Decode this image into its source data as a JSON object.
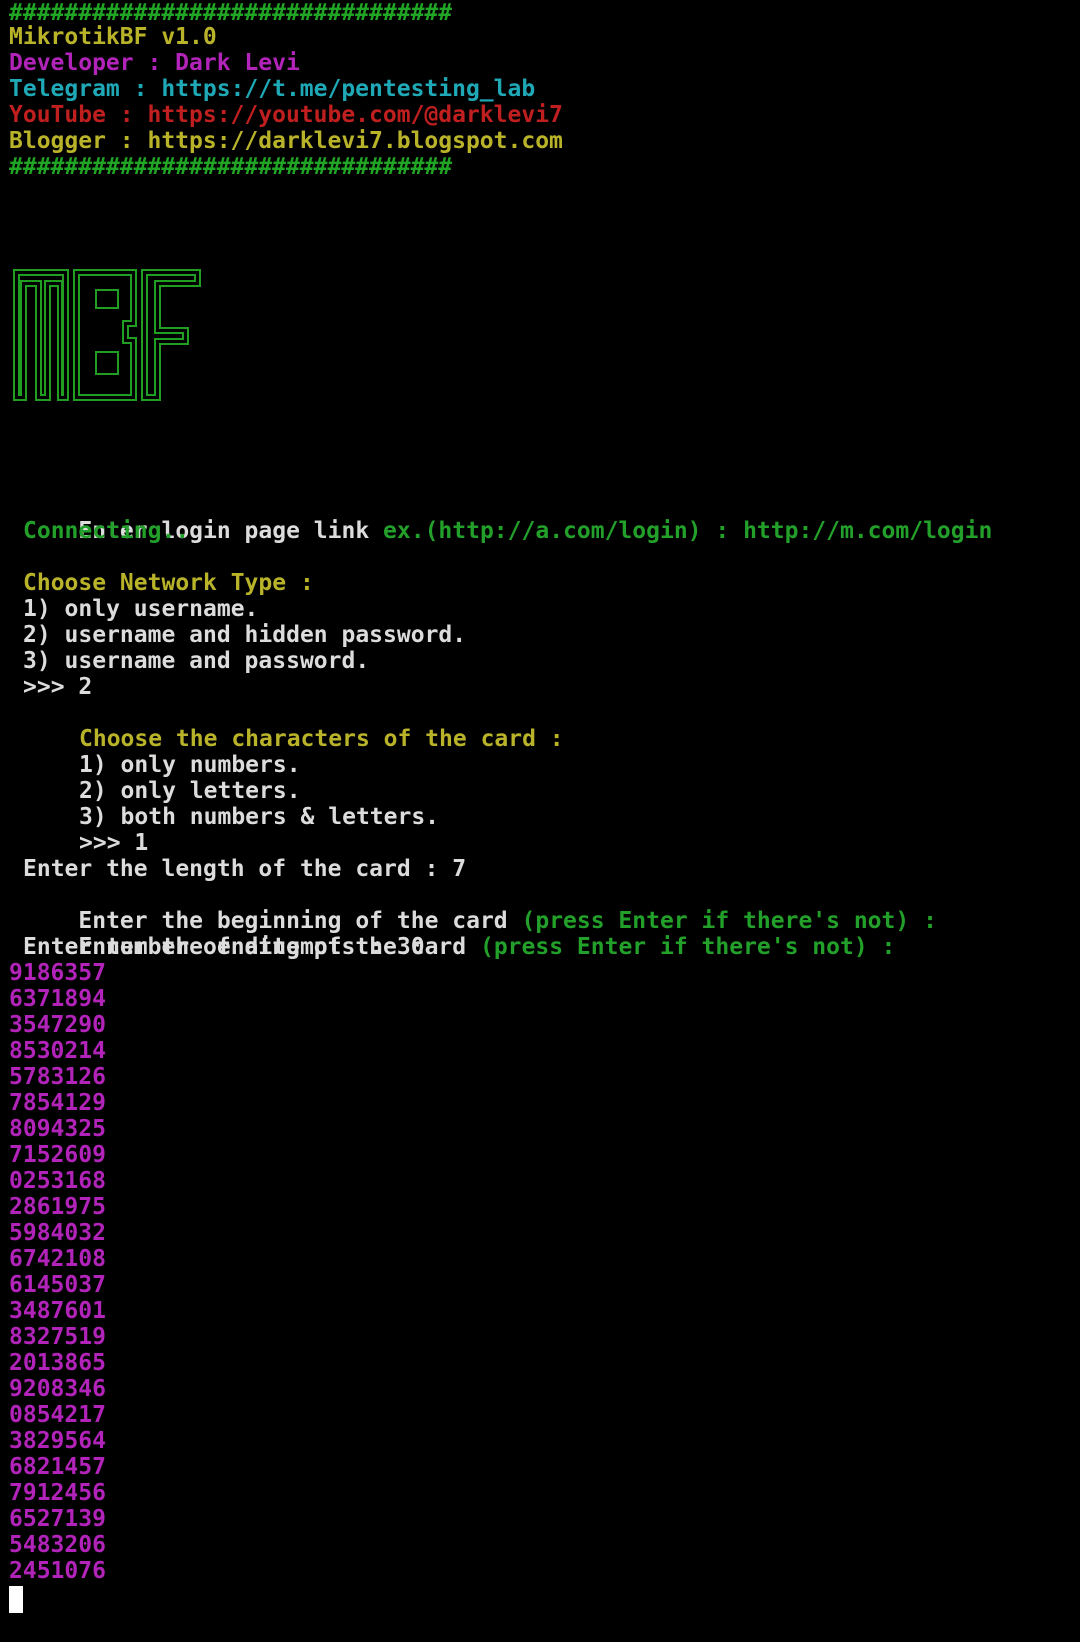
{
  "banner": {
    "hash_line": "################################",
    "title": "MikrotikBF v1.0",
    "developer": "Developer : Dark Levi",
    "telegram": "Telegram : https://t.me/pentesting_lab",
    "youtube": "YouTube : https://youtube.com/@darklevi7",
    "blogger": "Blogger : https://darklevi7.blogspot.com",
    "logo_text": "MBF"
  },
  "prompts": {
    "login_label": "Enter login page link ",
    "login_example": "ex.(http://a.com/login) : ",
    "login_value": "http://m.com/login",
    "connecting": "Connecting..",
    "network_header": "Choose Network Type :",
    "network_options": [
      "1) only username.",
      "2) username and hidden password.",
      "3) username and password."
    ],
    "network_answer": ">>> 2",
    "charset_header": "Choose the characters of the card :",
    "charset_options": [
      "1) only numbers.",
      "2) only letters.",
      "3) both numbers & letters."
    ],
    "charset_answer": ">>> 1",
    "length_line": "Enter the length of the card : 7",
    "beginning_label": "Enter the beginning of the card ",
    "beginning_hint": "(press Enter if there's not) :",
    "ending_label": "Enter the ending of the card ",
    "ending_hint": "(press Enter if there's not) :",
    "attempts_line": "Enter number of attempts : 30"
  },
  "codes": [
    "9186357",
    "6371894",
    "3547290",
    "8530214",
    "5783126",
    "7854129",
    "8094325",
    "7152609",
    "0253168",
    "2861975",
    "5984032",
    "6742108",
    "6145037",
    "3487601",
    "8327519",
    "2013865",
    "9208346",
    "0854217",
    "3829564",
    "6821457",
    "7912456",
    "6527139",
    "5483206",
    "2451076"
  ],
  "colors": {
    "background": "#000000",
    "green": "#22a02a",
    "yellow": "#b9b329",
    "magenta": "#b224b9",
    "cyan": "#1fa9b7",
    "red": "#c01f1f",
    "white": "#dcdcdc"
  }
}
